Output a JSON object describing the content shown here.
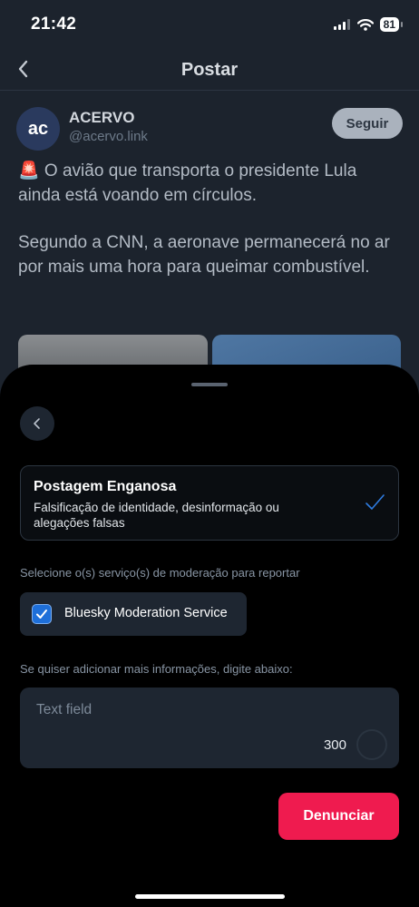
{
  "status_bar": {
    "time": "21:42",
    "battery": "81"
  },
  "header": {
    "title": "Postar"
  },
  "post": {
    "author_name": "ACERVO",
    "author_handle": "@acervo.link",
    "avatar_text": "ac",
    "follow_label": "Seguir",
    "paragraph1": "🚨 O avião que transporta o presidente Lula ainda está voando em círculos.",
    "paragraph2": "Segundo a CNN, a aeronave permanecerá no ar por mais uma hora para queimar combustível."
  },
  "report_sheet": {
    "reason": {
      "title": "Postagem Enganosa",
      "description": "Falsificação de identidade, desinformação ou alegações falsas"
    },
    "services_label": "Selecione o(s) serviço(s) de moderação para reportar",
    "service": {
      "label": "Bluesky Moderation Service",
      "checked": true
    },
    "details_label": "Se quiser adicionar mais informações, digite abaixo:",
    "text_field": {
      "placeholder": "Text field",
      "remaining": "300"
    },
    "submit_label": "Denunciar"
  },
  "colors": {
    "accent": "#ef1b4f",
    "checkbox": "#1e6fd9",
    "sheet_bg": "#000000",
    "page_bg": "#1c232d"
  }
}
